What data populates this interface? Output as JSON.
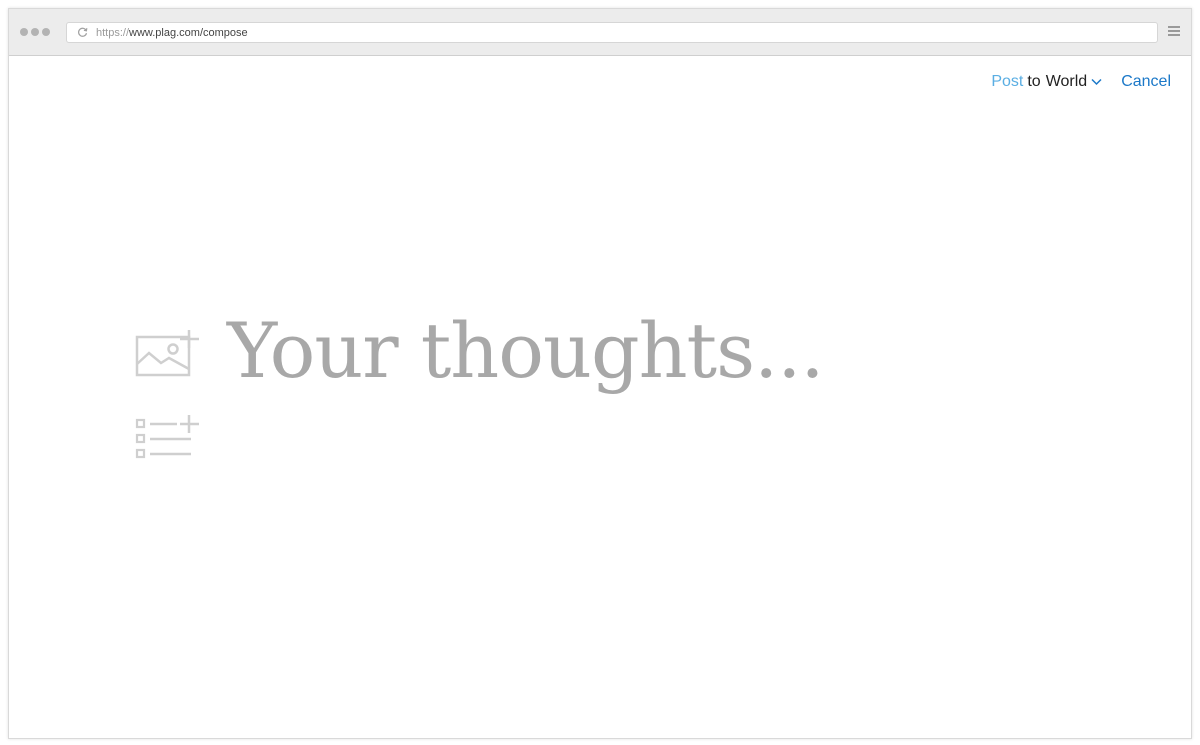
{
  "browser": {
    "url_scheme": "https://",
    "url_host_path": "www.plag.com/compose"
  },
  "topbar": {
    "post_label": "Post",
    "to_label": "to",
    "audience_label": "World",
    "cancel_label": "Cancel"
  },
  "composer": {
    "placeholder": "Your thoughts..."
  },
  "colors": {
    "post": "#5aaee3",
    "cancel": "#1b78c8",
    "placeholder": "#a8a8a8",
    "icons": "#cfcfcf"
  },
  "icons": {
    "reload": "reload-icon",
    "menu": "hamburger-menu-icon",
    "add_image": "add-image-icon",
    "add_list": "add-list-icon",
    "chevron": "chevron-down-icon"
  }
}
